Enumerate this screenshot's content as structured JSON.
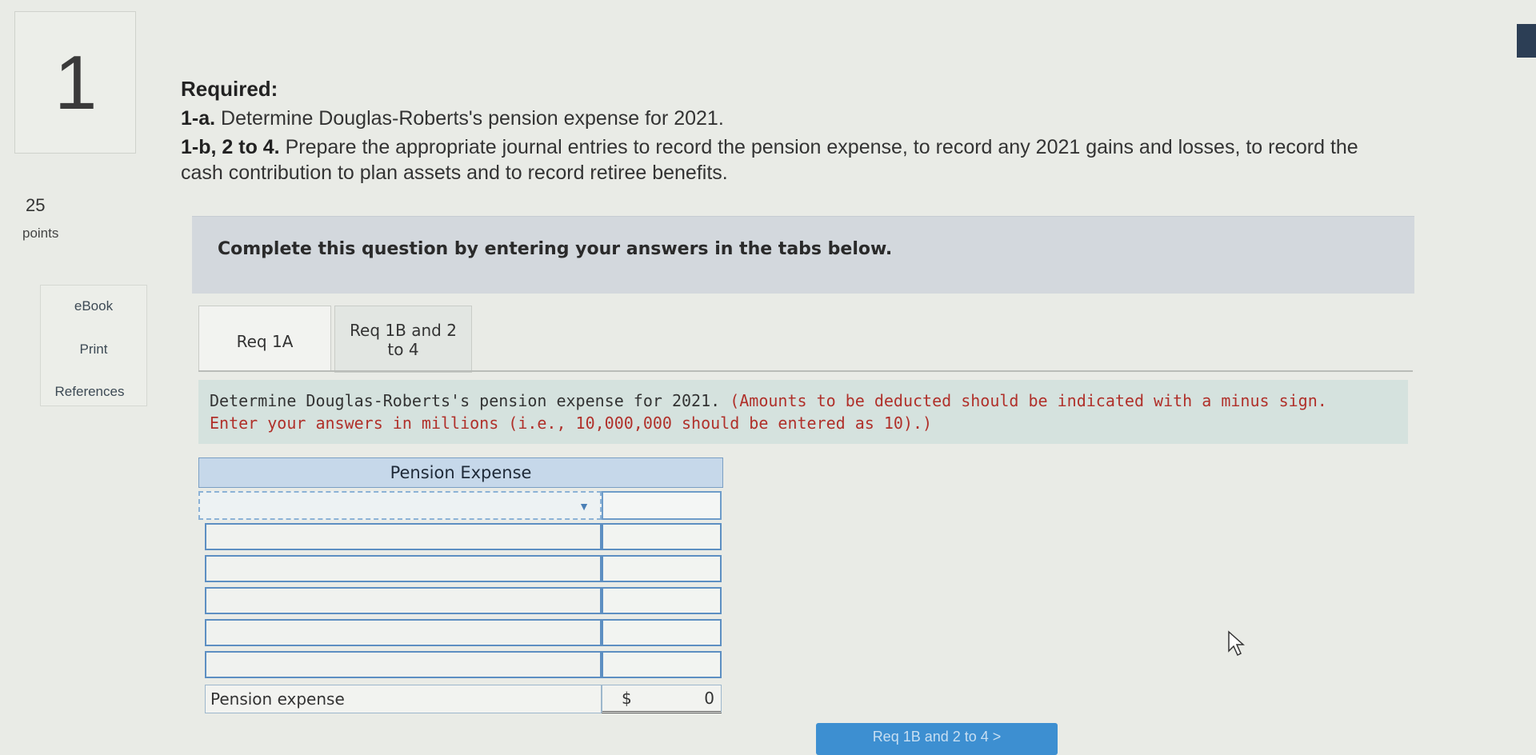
{
  "question": {
    "number": "1",
    "points_value": "25",
    "points_label": "points"
  },
  "side_nav": {
    "items": [
      "eBook",
      "Print",
      "References"
    ]
  },
  "required": {
    "heading": "Required:",
    "lines": [
      {
        "bold": "1-a.",
        "text": " Determine Douglas-Roberts's pension expense for 2021."
      },
      {
        "bold": "1-b, 2 to 4.",
        "text": " Prepare the appropriate journal entries to record the pension expense, to record any 2021 gains and losses, to record the"
      },
      {
        "bold": "",
        "text": "cash contribution to plan assets and to record retiree benefits."
      }
    ]
  },
  "banner": "Complete this question by entering your answers in the tabs below.",
  "tabs": [
    {
      "line1": "Req 1A",
      "line2": ""
    },
    {
      "line1": "Req 1B and 2",
      "line2": "to 4"
    }
  ],
  "instructions": {
    "line1_normal": "Determine Douglas-Roberts's pension expense for 2021.",
    "line1_red": " (Amounts to be deducted should be indicated with a minus sign.",
    "line2_red": "Enter your answers in millions (i.e., 10,000,000 should be entered as 10).)"
  },
  "table": {
    "title": "Pension Expense",
    "total_label": "Pension expense",
    "total_currency": "$",
    "total_value": "0"
  },
  "next_button": "Req 1B and 2 to 4 >"
}
